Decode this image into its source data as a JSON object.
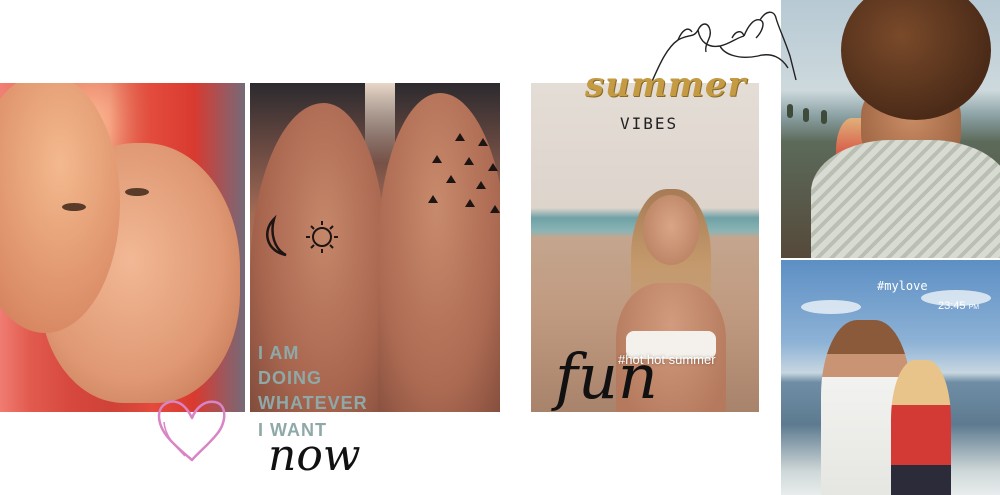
{
  "collage": {
    "quote_lines": [
      "I AM",
      "DOING",
      "WHATEVER",
      "I WANT"
    ],
    "quote_script": "now",
    "summer_script": "summer",
    "vibes_text": "VIBES",
    "hashtag_summer": "#hot hot summer",
    "fun_script": "fun",
    "hashtag_love": "#mylove",
    "clock_time": "23:45",
    "clock_ampm": "PM"
  },
  "colors": {
    "quote_text": "#8ea9a7",
    "summer_gold": "#c49a42",
    "heart_pink": "#d984c4"
  },
  "icons": [
    "heart-doodle-icon",
    "pinky-promise-hands-icon"
  ]
}
